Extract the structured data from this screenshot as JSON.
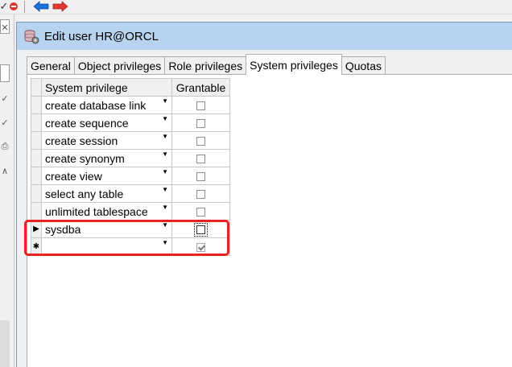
{
  "toolbar": {
    "icons": [
      "check-icon",
      "exit-icon",
      "back-arrow-icon",
      "forward-arrow-icon"
    ],
    "colors": {
      "blue_arrow": "#1f6fd8",
      "red_arrow": "#e23b2e"
    }
  },
  "left_strip": {
    "glyphs": [
      "✕",
      "✓",
      "✓",
      "⎙",
      "∧"
    ]
  },
  "dialog": {
    "title": "Edit user HR@ORCL",
    "titlebar_color": "#b8d3ef"
  },
  "tabs": [
    {
      "label": "General",
      "active": false
    },
    {
      "label": "Object privileges",
      "active": false
    },
    {
      "label": "Role privileges",
      "active": false
    },
    {
      "label": "System privileges",
      "active": true
    },
    {
      "label": "Quotas",
      "active": false
    }
  ],
  "grid": {
    "columns": [
      "System privilege",
      "Grantable"
    ],
    "rows": [
      {
        "privilege": "create database link",
        "grantable": false
      },
      {
        "privilege": "create sequence",
        "grantable": false
      },
      {
        "privilege": "create session",
        "grantable": false
      },
      {
        "privilege": "create synonym",
        "grantable": false
      },
      {
        "privilege": "create view",
        "grantable": false
      },
      {
        "privilege": "select any table",
        "grantable": false
      },
      {
        "privilege": "unlimited tablespace",
        "grantable": false
      },
      {
        "privilege": "sysdba",
        "grantable": false,
        "current": true
      },
      {
        "privilege": "",
        "grantable": true,
        "new_row": true
      }
    ],
    "indicators": {
      "current": "▶",
      "new": "✱"
    }
  },
  "annotation": {
    "color": "#e8231e"
  }
}
